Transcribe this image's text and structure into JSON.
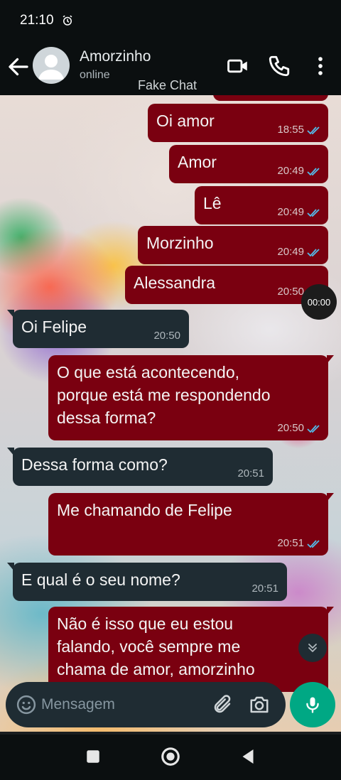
{
  "status_bar": {
    "time": "21:10",
    "alarm_icon": "alarm-clock-icon"
  },
  "header": {
    "contact_name": "Amorzinho",
    "contact_status": "online",
    "watermark": "Fake Chat",
    "icons": [
      "back-arrow-icon",
      "avatar-icon",
      "video-call-icon",
      "phone-icon",
      "more-vertical-icon"
    ]
  },
  "messages": [
    {
      "dir": "out",
      "text": "Oi amor",
      "time": "18:55",
      "read": true
    },
    {
      "dir": "out",
      "text": "Amor",
      "time": "20:49",
      "read": true
    },
    {
      "dir": "out",
      "text": "Lê",
      "time": "20:49",
      "read": true
    },
    {
      "dir": "out",
      "text": "Morzinho",
      "time": "20:49",
      "read": true
    },
    {
      "dir": "out",
      "text": "Alessandra",
      "time": "20:50",
      "read": true
    },
    {
      "dir": "in",
      "text": "Oi Felipe",
      "time": "20:50"
    },
    {
      "dir": "out",
      "text": "O que está acontecendo,\nporque está me respondendo\ndessa forma?",
      "time": "20:50",
      "read": true
    },
    {
      "dir": "in",
      "text": "Dessa forma como?",
      "time": "20:51"
    },
    {
      "dir": "out",
      "text": "Me chamando de Felipe",
      "time": "20:51",
      "read": true
    },
    {
      "dir": "in",
      "text": "E qual é o seu nome?",
      "time": "20:51"
    },
    {
      "dir": "out",
      "text": "Não é isso que eu estou\nfalando, você sempre me\nchama de amor, amorzinho",
      "time": "",
      "read": false
    }
  ],
  "audio_chip": {
    "label": "00:00"
  },
  "composer": {
    "placeholder": "Mensagem",
    "value": "",
    "icons": [
      "emoji-icon",
      "attach-icon",
      "camera-icon",
      "mic-icon"
    ]
  },
  "nav_bar": {
    "icons": [
      "recents-square-icon",
      "home-circle-icon",
      "back-triangle-icon"
    ]
  },
  "colors": {
    "outgoing_bubble": "#7a0010",
    "incoming_bubble": "#1f2c33",
    "read_ticks": "#53bdeb",
    "mic_button": "#00a884"
  }
}
